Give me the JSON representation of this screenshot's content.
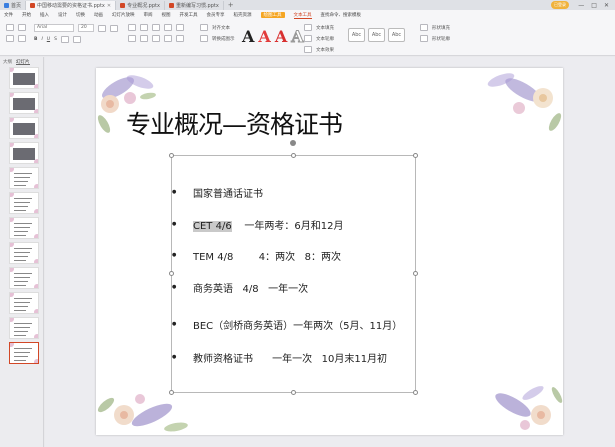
{
  "tabs": [
    {
      "label": "首页",
      "active": false
    },
    {
      "label": "中国移动需要的资格证书.pptx",
      "active": true
    },
    {
      "label": "专业概况.pptx",
      "active": false
    },
    {
      "label": "重新编写习惯.pptx",
      "active": false
    }
  ],
  "window": {
    "user": "已登录",
    "minimize": "—",
    "maximize": "□",
    "close": "✕"
  },
  "menu": [
    "文件",
    "开始",
    "插入",
    "设计",
    "切换",
    "动画",
    "幻灯片放映",
    "审阅",
    "视图",
    "开发工具",
    "会员专享",
    "稻壳资源",
    "绘图工具",
    "文本工具",
    "查找命令、搜索模板"
  ],
  "ribbon": {
    "font_name": "Arial",
    "font_size": "20",
    "text_fill": "文本填充",
    "text_outline": "文本轮廓",
    "text_effect": "文本效果",
    "shape_fill": "形状填充",
    "shape_outline": "形状轮廓",
    "align_text": "对齐文本",
    "convert_art": "转换成图示",
    "style_labels": [
      "Abc",
      "Abc",
      "Abc"
    ]
  },
  "left_panel": {
    "tabs": [
      "大纲",
      "幻灯片"
    ],
    "slide_count": 12,
    "selected": 12
  },
  "slide": {
    "title": "专业概况—资格证书",
    "items": [
      {
        "text": "国家普通话证书"
      },
      {
        "text_pre": "",
        "text_hl": "CET 4/6",
        "text_post": "    一年两考：6月和12月"
      },
      {
        "text": "TEM 4/8        4：两次   8：两次"
      },
      {
        "text": "商务英语   4/8   一年一次"
      },
      {
        "text": "BEC（剑桥商务英语）一年两次（5月、11月）"
      },
      {
        "text": "教师资格证书      一年一次   10月末11月初"
      }
    ]
  },
  "colors": {
    "accent": "#d24726",
    "member": "#f5a623"
  }
}
